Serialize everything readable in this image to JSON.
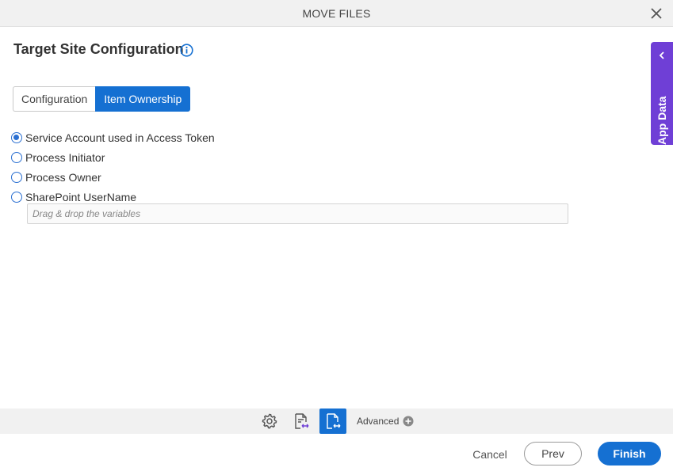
{
  "window": {
    "title": "MOVE FILES"
  },
  "heading": {
    "text": "Target Site Configuration"
  },
  "tabs": [
    {
      "label": "Configuration",
      "active": false
    },
    {
      "label": "Item Ownership",
      "active": true
    }
  ],
  "radio_options": [
    {
      "label": "Service Account used in Access Token",
      "checked": true
    },
    {
      "label": "Process Initiator",
      "checked": false
    },
    {
      "label": "Process Owner",
      "checked": false
    },
    {
      "label": "SharePoint UserName",
      "checked": false
    }
  ],
  "username_input": {
    "value": "",
    "placeholder": "Drag & drop the variables"
  },
  "side_panel": {
    "label": "App Data"
  },
  "footer_toolbar": {
    "advanced_label": "Advanced"
  },
  "buttons": {
    "cancel": "Cancel",
    "prev": "Prev",
    "finish": "Finish"
  },
  "colors": {
    "primary": "#1570d2",
    "app_data_panel": "#6f3fd6",
    "toolbar_bg": "#f1f1f1"
  }
}
